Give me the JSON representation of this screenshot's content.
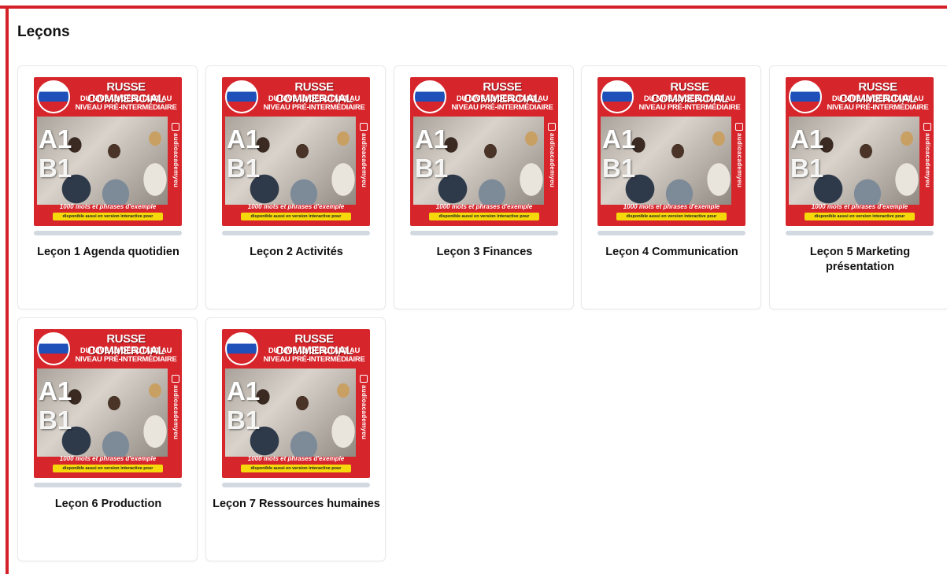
{
  "section": {
    "title": "Leçons"
  },
  "cover": {
    "title_line1": "RUSSE COMMERCIAL",
    "title_line2": "DU NIVEAU DÉBUTANT AU",
    "title_line3": "NIVEAU PRÉ-INTERMÉDIAIRE",
    "level_a": "A1",
    "level_b": "B1",
    "brand": "audioacademyeu",
    "words": "1000 mots et phrases d'exemple",
    "availability": "disponible aussi en version interactive pour"
  },
  "lessons": [
    {
      "label": "Leçon 1 Agenda quotidien",
      "progress": 0
    },
    {
      "label": "Leçon 2 Activités",
      "progress": 0
    },
    {
      "label": "Leçon 3 Finances",
      "progress": 0
    },
    {
      "label": "Leçon 4 Communication",
      "progress": 0
    },
    {
      "label": "Leçon 5 Marketing présentation",
      "progress": 0
    },
    {
      "label": "Leçon 6 Production",
      "progress": 0
    },
    {
      "label": "Leçon 7 Ressources humaines",
      "progress": 0
    }
  ],
  "colors": {
    "frame": "#d42128",
    "cover": "#d6262c",
    "progress_track": "#d3d9e1"
  }
}
